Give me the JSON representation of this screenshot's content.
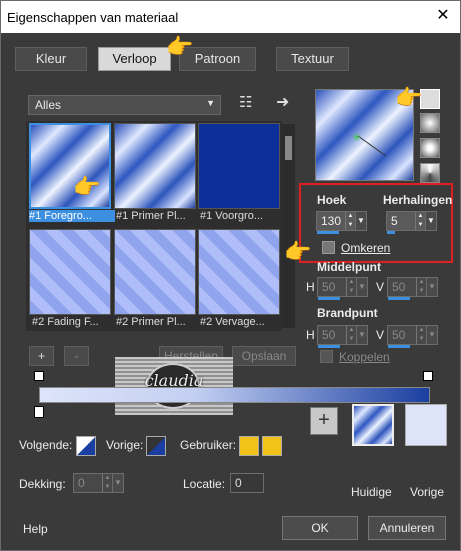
{
  "window": {
    "title": "Eigenschappen van materiaal",
    "close_glyph": "✕"
  },
  "tabs": [
    {
      "label": "Kleur",
      "active": false
    },
    {
      "label": "Verloop",
      "active": true
    },
    {
      "label": "Patroon",
      "active": false
    },
    {
      "label": "Textuur",
      "active": false
    }
  ],
  "category": {
    "selected": "Alles"
  },
  "gradients": [
    {
      "label": "#1 Foregro...",
      "selected": true
    },
    {
      "label": "#1 Primer Pl...",
      "selected": false
    },
    {
      "label": "#1 Voorgro...",
      "selected": false
    },
    {
      "label": "#2 Fading F...",
      "selected": false
    },
    {
      "label": "#2 Primer Pl...",
      "selected": false
    },
    {
      "label": "#2 Vervage...",
      "selected": false
    }
  ],
  "list_buttons": {
    "add": "+",
    "remove": "-",
    "restore": "Herstellen",
    "save": "Opslaan"
  },
  "settings": {
    "angle_label": "Hoek",
    "angle_value": "130",
    "repeats_label": "Herhalingen",
    "repeats_value": "5",
    "invert_label": "Omkeren",
    "center_label": "Middelpunt",
    "center_h_label": "H",
    "center_h": "50",
    "center_v_label": "V",
    "center_v": "50",
    "focal_label": "Brandpunt",
    "focal_h_label": "H",
    "focal_h": "50",
    "focal_v_label": "V",
    "focal_v": "50",
    "link_label": "Koppelen"
  },
  "watermark": {
    "text": "claudia"
  },
  "stops": {
    "follow_label": "Volgende:",
    "prev_label": "Vorige:",
    "user_label": "Gebruiker:",
    "opacity_label": "Dekking:",
    "opacity_value": "0",
    "location_label": "Locatie:",
    "location_value": "0"
  },
  "swatches": {
    "current_label": "Huidige",
    "previous_label": "Vorige",
    "add_glyph": "+"
  },
  "footer": {
    "help": "Help",
    "ok": "OK",
    "cancel": "Annuleren"
  },
  "colors": {
    "accent": "#3d8fe0",
    "highlight_box": "#e02020",
    "user_color": "#f2c21b",
    "bg_color": "#dde4fa",
    "fg_color": "#1a3fa0"
  }
}
